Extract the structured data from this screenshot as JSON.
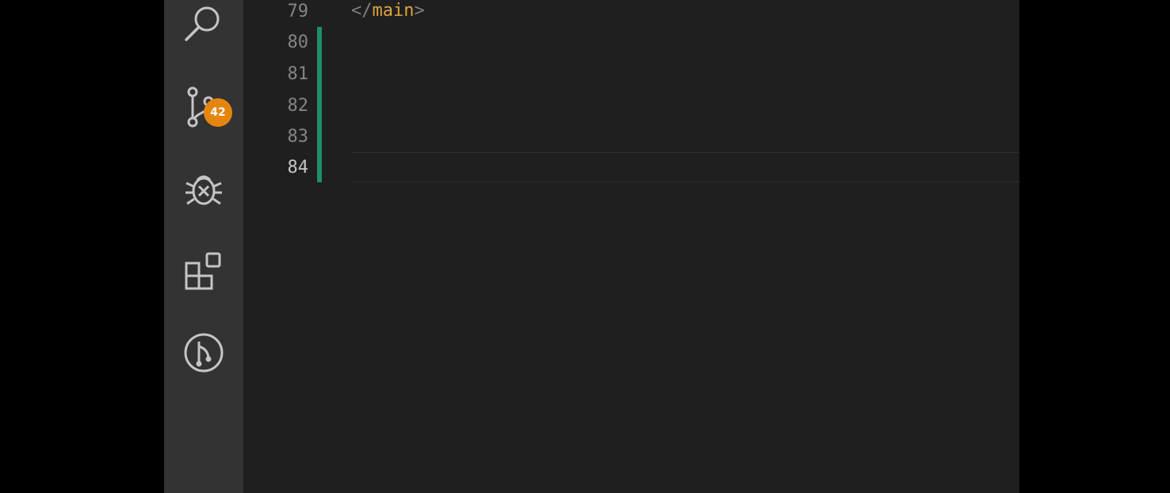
{
  "activity_bar": {
    "items": [
      {
        "name": "search",
        "icon": "search-icon"
      },
      {
        "name": "source-control",
        "icon": "source-control-icon",
        "badge": "42"
      },
      {
        "name": "run-and-debug",
        "icon": "debug-icon"
      },
      {
        "name": "extensions",
        "icon": "extensions-icon"
      },
      {
        "name": "git-graph",
        "icon": "git-graph-icon"
      }
    ],
    "badge_color": "#e6850e"
  },
  "editor": {
    "lines": [
      {
        "number": "79",
        "open": "</",
        "tag": "main",
        "close": ">"
      },
      {
        "number": "80"
      },
      {
        "number": "81"
      },
      {
        "number": "82"
      },
      {
        "number": "83"
      },
      {
        "number": "84"
      }
    ],
    "active_line": "84",
    "modified_gutter_color": "#1f8f6a",
    "tag_color": "#e0a43a"
  }
}
